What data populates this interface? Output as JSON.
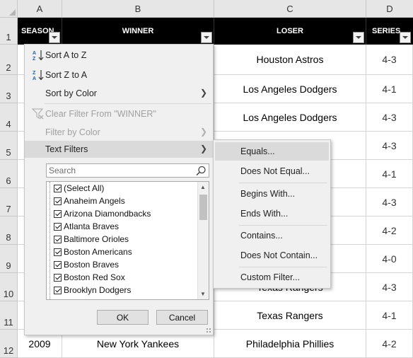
{
  "sheet": {
    "columns": [
      "A",
      "B",
      "C",
      "D"
    ],
    "rows": [
      "1",
      "2",
      "3",
      "4",
      "5",
      "6",
      "7",
      "8",
      "9",
      "10",
      "11",
      "12"
    ],
    "headers": {
      "season": "SEASON",
      "winner": "WINNER",
      "loser": "LOSER",
      "series": "SERIES"
    },
    "data": [
      {
        "loser": "Houston Astros",
        "series": "4-3"
      },
      {
        "loser": "Los Angeles Dodgers",
        "series": "4-1"
      },
      {
        "loser": "Los Angeles Dodgers",
        "series": "4-3"
      },
      {
        "loser": "",
        "series": "4-3"
      },
      {
        "loser": "",
        "series": "4-1"
      },
      {
        "loser": "",
        "series": "4-3"
      },
      {
        "loser": "",
        "series": "4-2"
      },
      {
        "loser": "",
        "series": "4-0"
      },
      {
        "loser": "Texas Rangers",
        "series": "4-3"
      },
      {
        "loser": "Texas Rangers",
        "series": "4-1"
      },
      {
        "season": "2009",
        "winner": "New York Yankees",
        "loser": "Philadelphia Phillies",
        "series": "4-2"
      }
    ]
  },
  "filter_menu": {
    "sort_az": "Sort A to Z",
    "sort_za": "Sort Z to A",
    "sort_by_color": "Sort by Color",
    "clear_filter": "Clear Filter From \"WINNER\"",
    "filter_by_color": "Filter by Color",
    "text_filters": "Text Filters",
    "search_placeholder": "Search",
    "items": [
      "(Select All)",
      "Anaheim Angels",
      "Arizona Diamondbacks",
      "Atlanta Braves",
      "Baltimore Orioles",
      "Boston Americans",
      "Boston Braves",
      "Boston Red Sox",
      "Brooklyn Dodgers"
    ],
    "ok": "OK",
    "cancel": "Cancel"
  },
  "text_filters_submenu": {
    "equals": "Equals...",
    "does_not_equal": "Does Not Equal...",
    "begins_with": "Begins With...",
    "ends_with": "Ends With...",
    "contains": "Contains...",
    "does_not_contain": "Does Not Contain...",
    "custom_filter": "Custom Filter..."
  }
}
